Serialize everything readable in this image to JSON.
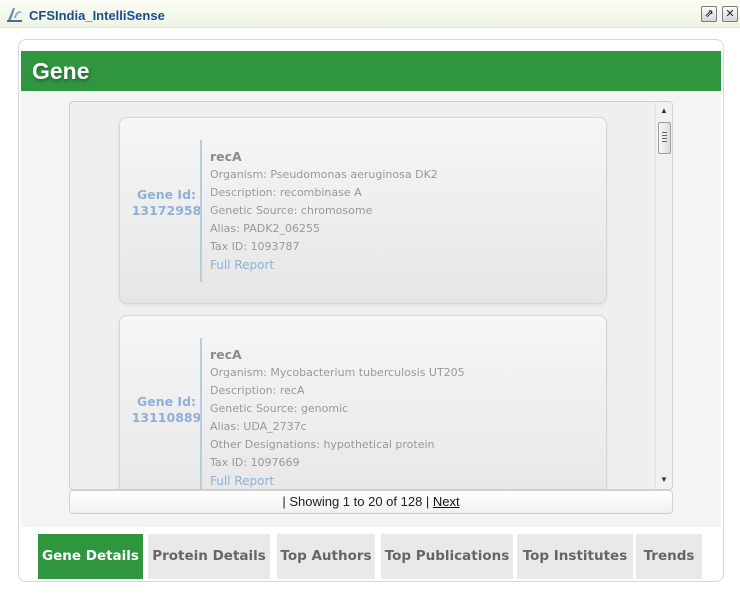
{
  "window": {
    "title": "CFSIndia_IntelliSense",
    "pin_glyph": "⇗",
    "close_glyph": "✕"
  },
  "header": {
    "title": "Gene"
  },
  "genes": [
    {
      "id_label": "Gene Id:",
      "id": "13172958",
      "name": "recA",
      "lines": [
        "Organism: Pseudomonas aeruginosa DK2",
        "Description: recombinase A",
        "Genetic Source: chromosome",
        "Alias: PADK2_06255",
        "Tax ID: 1093787"
      ],
      "link": "Full Report"
    },
    {
      "id_label": "Gene Id:",
      "id": "13110889",
      "name": "recA",
      "lines": [
        "Organism: Mycobacterium tuberculosis UT205",
        "Description: recA",
        "Genetic Source: genomic",
        "Alias: UDA_2737c",
        "Other Designations: hypothetical protein",
        "Tax ID: 1097669"
      ],
      "link": "Full Report"
    }
  ],
  "pager": {
    "showing": "| Showing 1 to 20 of 128 |",
    "next": "Next"
  },
  "tabs": [
    {
      "label": "Gene Details",
      "active": true
    },
    {
      "label": "Protein Details",
      "active": false
    },
    {
      "label": "Top Authors",
      "active": false
    },
    {
      "label": "Top Publications",
      "active": false
    },
    {
      "label": "Top Institutes",
      "active": false
    },
    {
      "label": "Trends",
      "active": false
    }
  ],
  "colors": {
    "brand_green": "#30953f",
    "link_blue": "#8fb0d6"
  },
  "icons": {
    "app": "app-icon",
    "scroll_up": "▲",
    "scroll_down": "▼"
  }
}
